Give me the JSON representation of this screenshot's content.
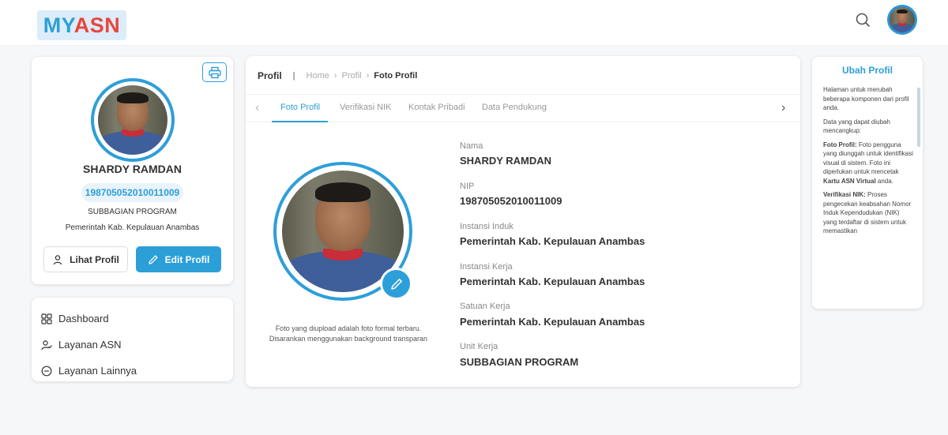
{
  "header": {
    "logo_my": "MY",
    "logo_asn": "ASN"
  },
  "profile": {
    "name": "SHARDY RAMDAN",
    "nip": "198705052010011009",
    "unit": "SUBBAGIAN PROGRAM",
    "instansi": "Pemerintah Kab. Kepulauan Anambas",
    "btn_view": "Lihat Profil",
    "btn_edit": "Edit Profil"
  },
  "menu": {
    "items": [
      {
        "label": "Dashboard",
        "icon": "dashboard-icon"
      },
      {
        "label": "Layanan ASN",
        "icon": "user-check-icon"
      },
      {
        "label": "Layanan Lainnya",
        "icon": "more-circle-icon"
      }
    ]
  },
  "breadcrumb": {
    "title": "Profil",
    "home": "Home",
    "profil": "Profil",
    "current": "Foto Profil"
  },
  "tabs": [
    "Foto Profil",
    "Verifikasi NIK",
    "Kontak Pribadi",
    "Data Pendukung"
  ],
  "photo_note": {
    "line1": "Foto yang diupload adalah foto formal terbaru.",
    "line2": "Disarankan menggunakan background transparan"
  },
  "fields": [
    {
      "label": "Nama",
      "value": "SHARDY RAMDAN"
    },
    {
      "label": "NIP",
      "value": "198705052010011009"
    },
    {
      "label": "Instansi Induk",
      "value": "Pemerintah Kab. Kepulauan Anambas"
    },
    {
      "label": "Instansi Kerja",
      "value": "Pemerintah Kab. Kepulauan Anambas"
    },
    {
      "label": "Satuan Kerja",
      "value": "Pemerintah Kab. Kepulauan Anambas"
    },
    {
      "label": "Unit Kerja",
      "value": "SUBBAGIAN PROGRAM"
    }
  ],
  "help": {
    "title": "Ubah Profil",
    "p1": "Halaman untuk merubah beberapa komponen dari profil anda.",
    "p2": "Data yang dapat diubah mencangkup:",
    "p3_bold": "Foto Profil:",
    "p3_text": " Foto pengguna yang diunggah untuk identifikasi visual di sistem. Foto ini diperlukan untuk mencetak ",
    "p3_bold2": "Kartu ASN Virtual",
    "p3_text2": " anda.",
    "p4_bold": "Verifikasi NIK:",
    "p4_text": " Proses pengecekan keabsahan Nomor Induk Kependudukan (NIK) yang terdaftar di sistem untuk memastikan"
  },
  "colors": {
    "accent": "#2d9fd8",
    "logo_red": "#e8473c"
  }
}
